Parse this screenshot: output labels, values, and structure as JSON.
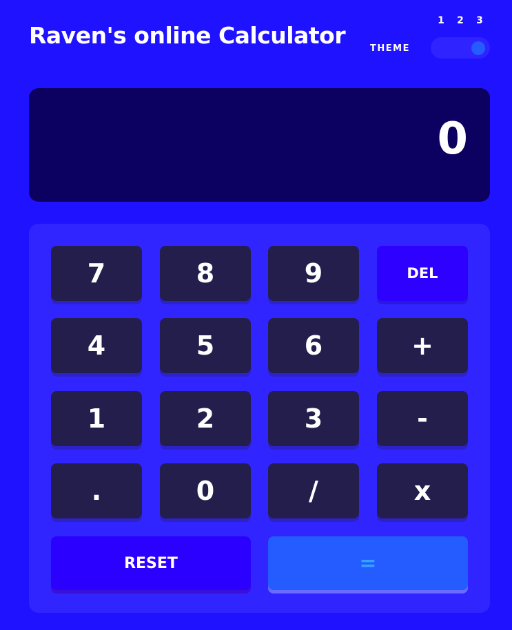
{
  "header": {
    "title": "Raven's online Calculator",
    "theme_label": "THEME",
    "theme_options": [
      "1",
      "2",
      "3"
    ],
    "theme_selected": "3"
  },
  "display": {
    "value": "0"
  },
  "keypad": {
    "keys": {
      "k7": "7",
      "k8": "8",
      "k9": "9",
      "del": "DEL",
      "k4": "4",
      "k5": "5",
      "k6": "6",
      "plus": "+",
      "k1": "1",
      "k2": "2",
      "k3": "3",
      "minus": "-",
      "dot": ".",
      "k0": "0",
      "divide": "/",
      "multiply": "x",
      "reset": "RESET",
      "equals": "="
    }
  },
  "colors": {
    "background": "#1f12ff",
    "screen": "#0c0060",
    "keypad": "#3025ff",
    "key": "#241e4c",
    "del_key": "#2d00ff",
    "reset_key": "#2b00ff",
    "equals_key": "#255cff",
    "equals_text": "#35a4ff"
  }
}
